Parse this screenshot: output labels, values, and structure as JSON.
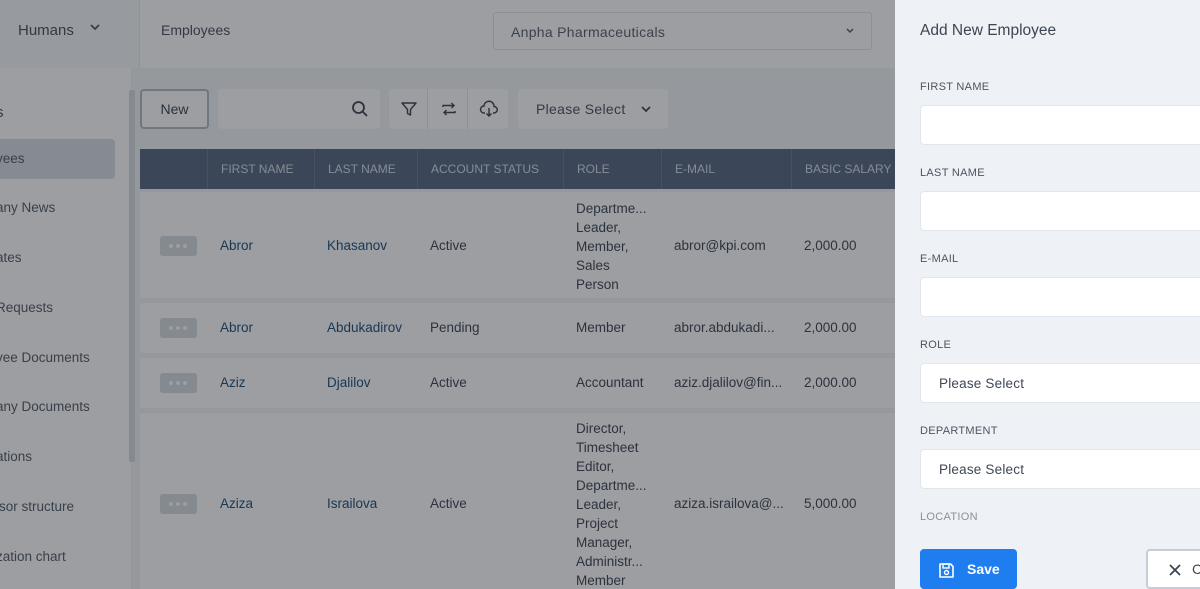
{
  "topbar": {
    "module": "Humans",
    "page_title": "Employees",
    "company": "Anpha Pharmaceuticals"
  },
  "sidebar": {
    "heading": "s",
    "items": [
      {
        "label": "yees",
        "active": true
      },
      {
        "label": "any News"
      },
      {
        "label": "ates"
      },
      {
        "label": "Requests"
      },
      {
        "label": "yee Documents"
      },
      {
        "label": "any Documents"
      },
      {
        "label": "ations"
      },
      {
        "label": "isor structure"
      },
      {
        "label": "zation chart"
      }
    ]
  },
  "toolbar": {
    "new_label": "New",
    "search_value": "",
    "filter_placeholder": "Please Select"
  },
  "table": {
    "columns": [
      "FIRST NAME",
      "LAST NAME",
      "ACCOUNT STATUS",
      "ROLE",
      "E-MAIL",
      "BASIC SALARY"
    ],
    "rows": [
      {
        "first": "Abror",
        "last": "Khasanov",
        "status": "Active",
        "role": "Departme... Leader, Member, Sales Person",
        "email": "abror@kpi.com",
        "salary": "2,000.00"
      },
      {
        "first": "Abror",
        "last": "Abdukadirov",
        "status": "Pending",
        "role": "Member",
        "email": "abror.abdukadi...",
        "salary": "2,000.00"
      },
      {
        "first": "Aziz",
        "last": "Djalilov",
        "status": "Active",
        "role": "Accountant",
        "email": "aziz.djalilov@fin...",
        "salary": "2,000.00"
      },
      {
        "first": "Aziza",
        "last": "Israilova",
        "status": "Active",
        "role": "Director, Timesheet Editor, Departme... Leader, Project Manager, Administr... Member",
        "email": "aziza.israilova@...",
        "salary": "5,000.00"
      }
    ]
  },
  "drawer": {
    "title": "Add New Employee",
    "fields": {
      "first_name": {
        "label": "FIRST NAME",
        "value": ""
      },
      "last_name": {
        "label": "LAST NAME",
        "value": ""
      },
      "email": {
        "label": "E-MAIL",
        "value": ""
      },
      "role": {
        "label": "ROLE",
        "value": "Please Select"
      },
      "department": {
        "label": "DEPARTMENT",
        "value": "Please Select"
      },
      "location": {
        "label": "LOCATION"
      }
    },
    "save_label": "Save",
    "cancel_label": "C"
  },
  "colors": {
    "primary": "#1e7ef0",
    "table_header": "#5a6883",
    "link": "#1f4f7a"
  }
}
